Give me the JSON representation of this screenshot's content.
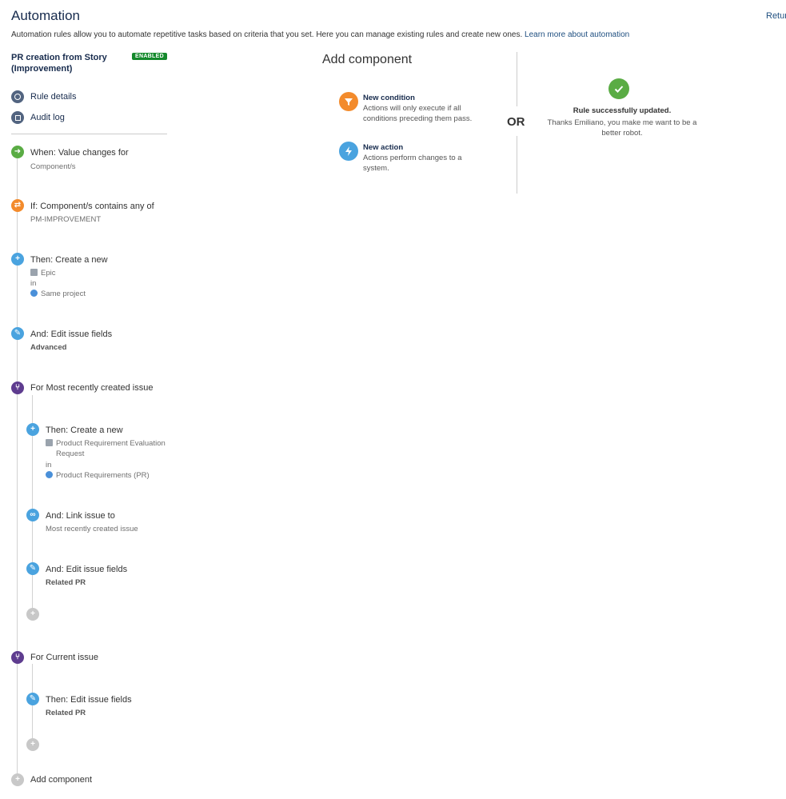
{
  "header": {
    "title": "Automation",
    "return_label": "Retur",
    "description": "Automation rules allow you to automate repetitive tasks based on criteria that you set. Here you can manage existing rules and create new ones.",
    "learn_more": "Learn more about automation"
  },
  "rule": {
    "name": "PR creation from Story (Improvement)",
    "status": "ENABLED"
  },
  "nav": {
    "rule_details": "Rule details",
    "audit_log": "Audit log"
  },
  "steps": {
    "trigger": {
      "title": "When: Value changes for",
      "sub": "Component/s"
    },
    "condition": {
      "title": "If: Component/s contains any of",
      "sub": "PM-IMPROVEMENT"
    },
    "create_epic": {
      "title": "Then: Create a new",
      "type": "Epic",
      "in": "in",
      "project": "Same project"
    },
    "edit_fields": {
      "title": "And: Edit issue fields",
      "sub": "Advanced"
    },
    "branch_recent": {
      "title": "For Most recently created issue"
    },
    "create_pr": {
      "title": "Then: Create a new",
      "type_line1": "Product Requirement Evaluation",
      "type_line2": "Request",
      "in": "in",
      "project": "Product Requirements (PR)"
    },
    "link_issue": {
      "title": "And: Link issue to",
      "sub": "Most recently created issue"
    },
    "edit_related": {
      "title": "And: Edit issue fields",
      "sub": "Related PR"
    },
    "branch_current": {
      "title": "For Current issue"
    },
    "edit_current": {
      "title": "Then: Edit issue fields",
      "sub": "Related PR"
    },
    "add_component": {
      "title": "Add component"
    }
  },
  "add_panel": {
    "title": "Add component",
    "condition_title": "New condition",
    "condition_desc": "Actions will only execute if all conditions preceding them pass.",
    "action_title": "New action",
    "action_desc": "Actions perform changes to a system.",
    "or_label": "OR"
  },
  "success": {
    "title": "Rule successfully updated.",
    "message": "Thanks Emiliano, you make me want to be a better robot."
  },
  "colors": {
    "link": "#205081",
    "enabled": "#14892c",
    "trigger": "#5aac44",
    "condition": "#f38b2c",
    "action": "#4aa3df",
    "branch": "#5e3c8f"
  }
}
